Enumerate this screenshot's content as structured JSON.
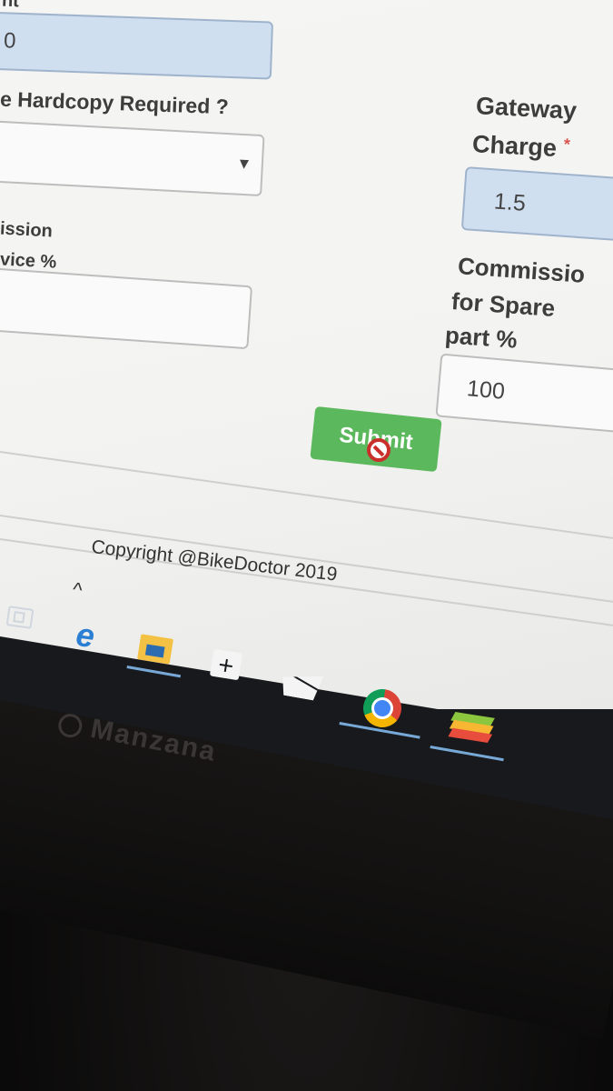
{
  "form": {
    "top_label_fragment": "nt",
    "top_input_value": "0",
    "hardcopy_label": "e Hardcopy Required ?",
    "hardcopy_select_value": "",
    "commission_service_label_line1": "ission",
    "commission_service_label_line2": "vice %",
    "commission_service_value": "",
    "gateway_label_line1": "Gateway",
    "gateway_label_line2": "Charge",
    "required_marker": "*",
    "gateway_value": "1.5",
    "commission_spare_label_line1": "Commissio",
    "commission_spare_label_line2": "for Spare",
    "commission_spare_label_line3": "part %",
    "commission_spare_value": "100",
    "submit_label": "Submit",
    "select_arrow": "▾"
  },
  "footer": {
    "copyright": "Copyright @BikeDoctor 2019"
  },
  "taskbar": {
    "chevron": "^",
    "edge_glyph": "e",
    "icons": [
      "task-view-icon",
      "edge-icon",
      "file-explorer-icon",
      "store-icon",
      "mail-icon",
      "chrome-icon",
      "bluestacks-icon"
    ]
  },
  "monitor": {
    "brand": "Manzana"
  },
  "colors": {
    "submit_green": "#5cb85c",
    "input_blue": "#cfdff0",
    "required_red": "#d9534f",
    "taskbar_bg": "#17191c",
    "active_underline": "#78a9d6"
  }
}
